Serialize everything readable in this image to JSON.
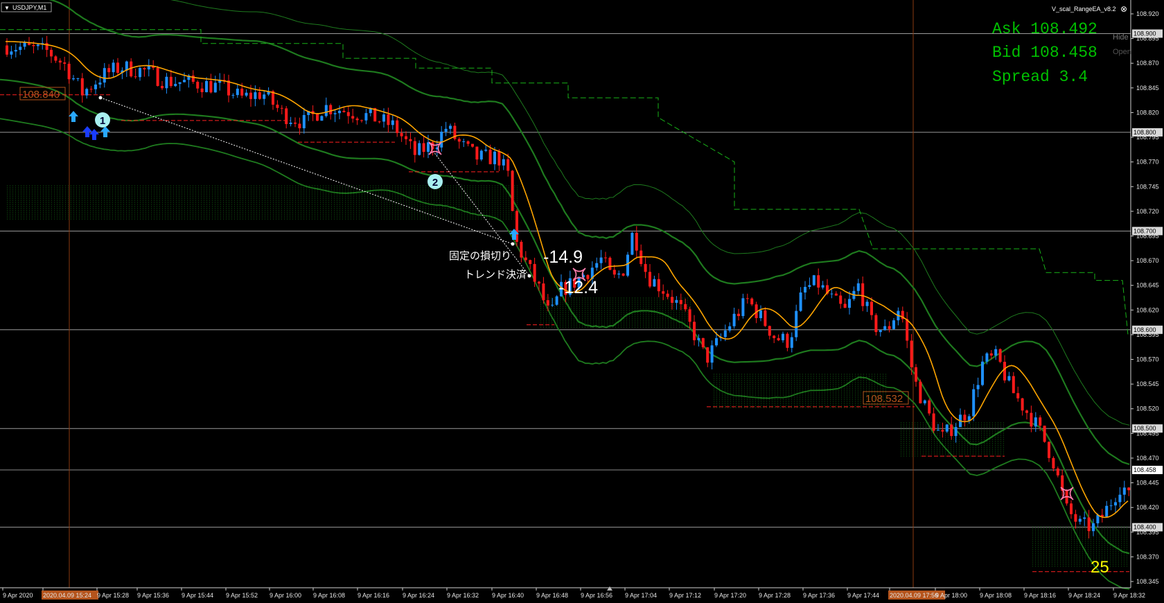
{
  "window": {
    "symbol_title": "USDJPY,M1",
    "ea_name": "V_scal_RangeEA_v8.2",
    "close_glyph": "⊗",
    "menu_glyph": "▼",
    "hide_label": "Hide",
    "open_label": "Open"
  },
  "quote_panel": {
    "ask": "Ask 108.492",
    "bid": "Bid 108.458",
    "spread": "Spread 3.4"
  },
  "price_axis": {
    "ticks": [
      "108.920",
      "108.895",
      "108.870",
      "108.845",
      "108.820",
      "108.795",
      "108.770",
      "108.745",
      "108.720",
      "108.695",
      "108.670",
      "108.645",
      "108.620",
      "108.595",
      "108.570",
      "108.545",
      "108.520",
      "108.495",
      "108.470",
      "108.445",
      "108.420",
      "108.395",
      "108.370",
      "108.345"
    ],
    "boxed": [
      {
        "label": "108.900",
        "color": "#d9d9d9"
      },
      {
        "label": "108.800",
        "color": "#d9d9d9"
      },
      {
        "label": "108.700",
        "color": "#d9d9d9"
      },
      {
        "label": "108.600",
        "color": "#d9d9d9"
      },
      {
        "label": "108.500",
        "color": "#d9d9d9"
      },
      {
        "label": "108.458",
        "color": "#ffffff"
      },
      {
        "label": "108.400",
        "color": "#d9d9d9"
      }
    ]
  },
  "time_axis": {
    "labels": [
      "9 Apr 2020",
      "2020.04.09 15:24",
      "9 Apr 15:28",
      "9 Apr 15:36",
      "9 Apr 15:44",
      "9 Apr 15:52",
      "9 Apr 16:00",
      "9 Apr 16:08",
      "9 Apr 16:16",
      "9 Apr 16:24",
      "9 Apr 16:32",
      "9 Apr 16:40",
      "9 Apr 16:48",
      "9 Apr 16:56",
      "9 Apr 17:04",
      "9 Apr 17:12",
      "9 Apr 17:20",
      "9 Apr 17:28",
      "9 Apr 17:36",
      "9 Apr 17:44",
      "2020.04.09 17:56",
      "9 Apr 18:00",
      "9 Apr 18:08",
      "9 Apr 18:16",
      "9 Apr 18:24",
      "9 Apr 18:32"
    ],
    "highlighted": [
      "2020.04.09 15:24",
      "2020.04.09 17:56"
    ]
  },
  "annotations": {
    "range_high_1": "108.840",
    "range_low_2": "108.532",
    "fixed_stop": "固定の損切り",
    "trend_exit": "トレンド決済",
    "pl_1": "-14.9",
    "pl_2": "-12.4",
    "marker_1": "1",
    "marker_2": "2",
    "counter": "25"
  },
  "colors": {
    "bull": "#1e90ff",
    "bear": "#ff1a1a",
    "ma": "#ffa500",
    "band": "#1e7a1e",
    "dash_green": "#19b319",
    "range_red": "#ff2020",
    "quote_green": "#00c000",
    "axis_highlight": "#b5541c",
    "counter": "#ffff00"
  },
  "icons": {
    "entry": "up-arrow-icon",
    "exit": "cross-x-icon",
    "close": "close-icon",
    "menu": "dropdown-arrow-icon"
  }
}
